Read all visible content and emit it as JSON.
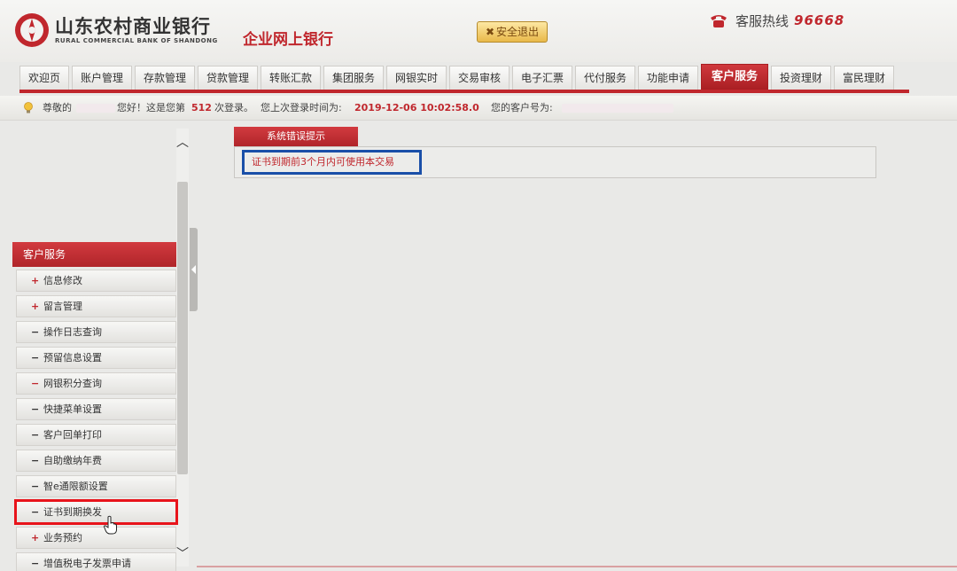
{
  "header": {
    "bank_name": "山东农村商业银行",
    "bank_name_en": "RURAL COMMERCIAL BANK OF SHANDONG",
    "product_title": "企业网上银行",
    "logout_label": "安全退出",
    "hotline_label": "客服热线",
    "hotline_number": "96668"
  },
  "nav": {
    "tabs": [
      {
        "label": "欢迎页"
      },
      {
        "label": "账户管理"
      },
      {
        "label": "存款管理"
      },
      {
        "label": "贷款管理"
      },
      {
        "label": "转账汇款"
      },
      {
        "label": "集团服务"
      },
      {
        "label": "网银实时"
      },
      {
        "label": "交易审核"
      },
      {
        "label": "电子汇票"
      },
      {
        "label": "代付服务"
      },
      {
        "label": "功能申请"
      },
      {
        "label": "客户服务"
      },
      {
        "label": "投资理财"
      },
      {
        "label": "富民理财"
      }
    ],
    "active_tab": "客户服务"
  },
  "infobar": {
    "greeting_prefix": "尊敬的",
    "greeting_suffix": "您好！这是您第",
    "login_count": "512",
    "login_count_suffix": "次登录。",
    "last_login_label": "您上次登录时间为:",
    "last_login_time": "2019-12-06 10:02:58.0",
    "customer_no_label": "您的客户号为:"
  },
  "sidebar": {
    "title": "客户服务",
    "items": [
      {
        "sym": "+",
        "label": "信息修改"
      },
      {
        "sym": "+",
        "label": "留言管理"
      },
      {
        "sym": "−",
        "label": "操作日志查询"
      },
      {
        "sym": "−",
        "label": "预留信息设置"
      },
      {
        "sym": "−",
        "label": "网银积分查询"
      },
      {
        "sym": "−",
        "label": "快捷菜单设置"
      },
      {
        "sym": "−",
        "label": "客户回单打印"
      },
      {
        "sym": "−",
        "label": "自助缴纳年费"
      },
      {
        "sym": "−",
        "label": "智e通限额设置"
      },
      {
        "sym": "−",
        "label": "证书到期换发"
      },
      {
        "sym": "+",
        "label": "业务预约"
      },
      {
        "sym": "−",
        "label": "增值税电子发票申请"
      }
    ],
    "highlighted_item": "证书到期换发"
  },
  "content": {
    "error_tab_label": "系统错误提示",
    "error_message": "证书到期前3个月内可使用本交易"
  },
  "colors": {
    "brand_red": "#c0272d",
    "highlight_blue": "#1a4fa8",
    "highlight_red": "#e8141b"
  }
}
